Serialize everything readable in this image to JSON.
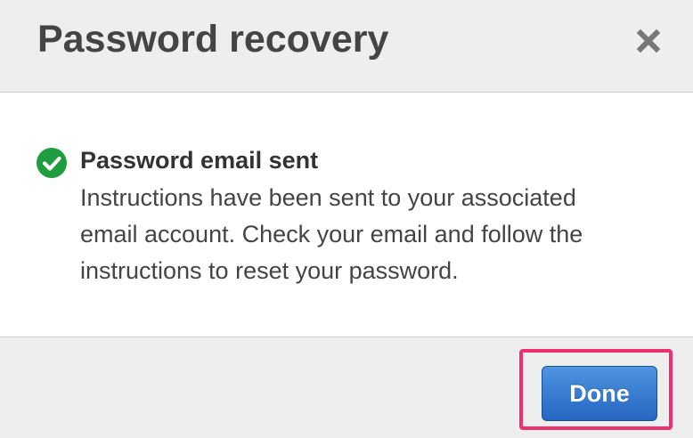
{
  "dialog": {
    "title": "Password recovery",
    "close_icon": "close-icon",
    "message": {
      "icon": "check-circle-icon",
      "heading": "Password email sent",
      "lines": [
        "Instructions have been sent to your associated",
        "email account. Check your email and follow the",
        "instructions to reset your password."
      ]
    },
    "done_label": "Done"
  },
  "colors": {
    "success": "#1e9e3e",
    "primary_button": "#2f74cf",
    "highlight": "#f0306e",
    "header_bg": "#eeeeee"
  }
}
